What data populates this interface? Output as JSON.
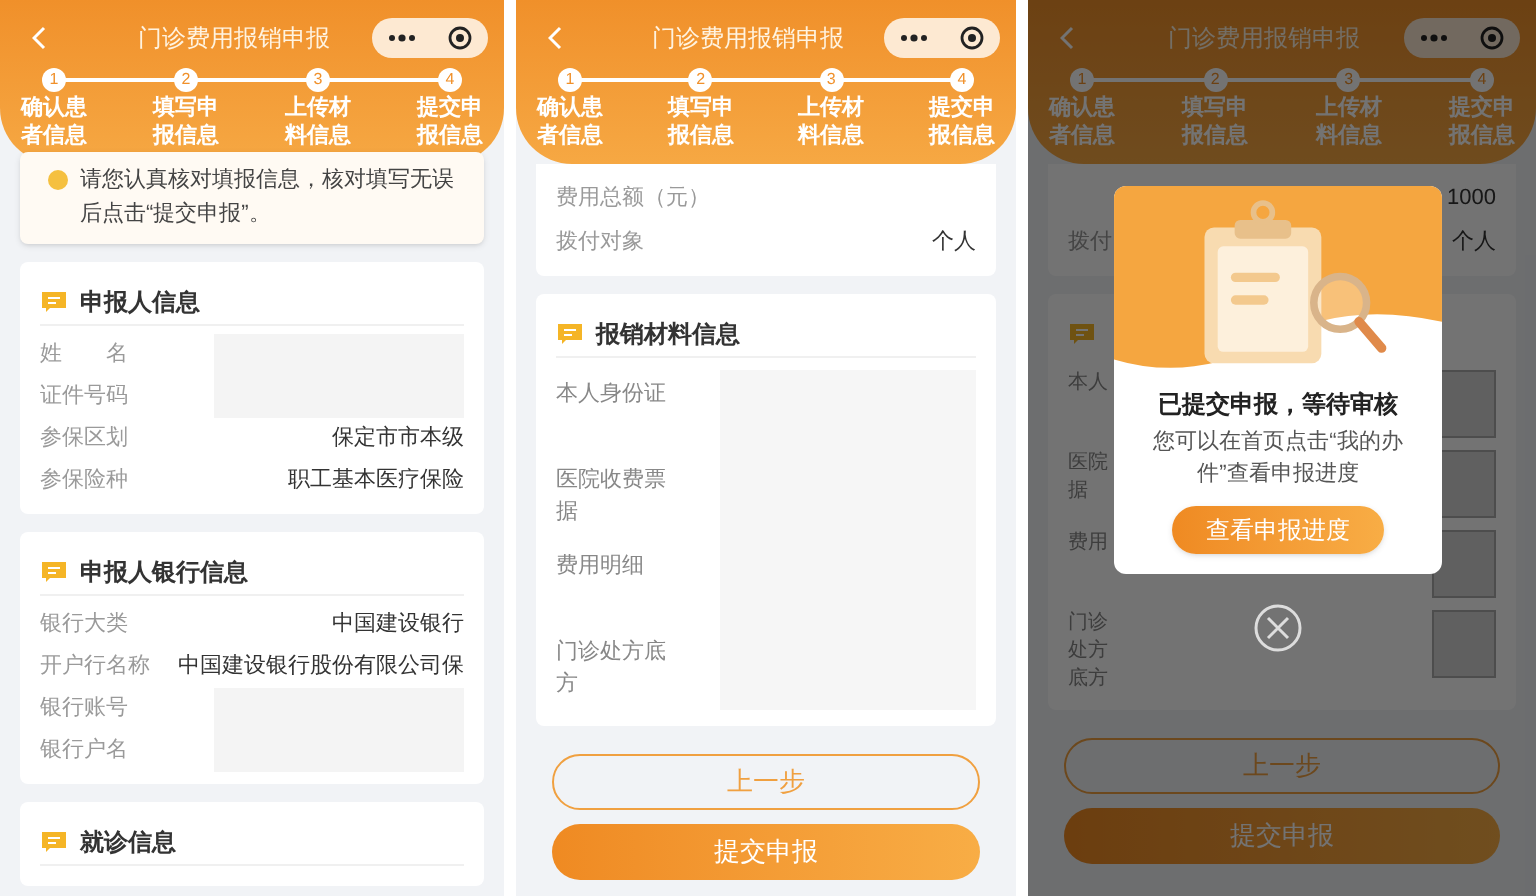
{
  "screen_1": {
    "header": {
      "title": "门诊费用报销申报",
      "steps": [
        {
          "number": "1",
          "label": "确认患者信息"
        },
        {
          "number": "2",
          "label": "填写申报信息"
        },
        {
          "number": "3",
          "label": "上传材料信息"
        },
        {
          "number": "4",
          "label": "提交申报信息"
        }
      ]
    },
    "notice": "请您认真核对填报信息，核对填写无误后点击“提交申报”。",
    "sections": [
      {
        "title": "申报人信息",
        "rows": [
          {
            "label": "姓　　名",
            "hidden": true
          },
          {
            "label": "证件号码",
            "hidden": true
          },
          {
            "label": "参保区划",
            "value": "保定市市本级",
            "hidden": false
          },
          {
            "label": "参保险种",
            "value": "职工基本医疗保险",
            "hidden": false
          }
        ]
      },
      {
        "title": "申报人银行信息",
        "rows": [
          {
            "label": "银行大类",
            "value": "中国建设银行",
            "hidden": false
          },
          {
            "label": "开户行名称",
            "value": "中国建设银行股份有限公司保",
            "hidden": false
          },
          {
            "label": "银行账号",
            "hidden": true
          },
          {
            "label": "银行户名",
            "hidden": true
          }
        ]
      },
      {
        "title": "就诊信息"
      }
    ]
  },
  "screen_2": {
    "header": {
      "title": "门诊费用报销申报",
      "steps": [
        {
          "number": "1",
          "label": "确认患者信息"
        },
        {
          "number": "2",
          "label": "填写申报信息"
        },
        {
          "number": "3",
          "label": "上传材料信息"
        },
        {
          "number": "4",
          "label": "提交申报信息"
        }
      ]
    },
    "summary": [
      {
        "label": "费用总额（元）"
      },
      {
        "label": "拨付对象",
        "value": "个人"
      }
    ],
    "materials": {
      "title": "报销材料信息",
      "rows": [
        {
          "label": "本人身份证"
        },
        {
          "label": "医院收费票据"
        },
        {
          "label": "费用明细"
        },
        {
          "label": "门诊处方底方"
        }
      ]
    },
    "buttons": [
      {
        "kind": "outline",
        "label": "上一步"
      },
      {
        "kind": "primary",
        "label": "提交申报"
      }
    ]
  },
  "screen_3": {
    "header": {
      "title": "门诊费用报销申报",
      "steps": [
        {
          "number": "1",
          "label": "确认患者信息"
        },
        {
          "number": "2",
          "label": "填写申报信息"
        },
        {
          "number": "3",
          "label": "上传材料信息"
        },
        {
          "number": "4",
          "label": "提交申报信息"
        }
      ]
    },
    "summary": [
      {
        "value": "1000"
      },
      {
        "label": "拨付",
        "value": "个人"
      }
    ],
    "materials": {
      "rows": [
        {
          "label": "本人"
        },
        {
          "label": "医院据"
        },
        {
          "label": "费用"
        },
        {
          "label": "门诊处方底方"
        }
      ]
    },
    "buttons": [
      {
        "kind": "outline",
        "label": "上一步"
      },
      {
        "kind": "primary",
        "label": "提交申报"
      }
    ],
    "dialog": {
      "title": "已提交申报，等待审核",
      "message": "您可以在首页点击“我的办件”查看申报进度",
      "button": "查看申报进度"
    }
  }
}
